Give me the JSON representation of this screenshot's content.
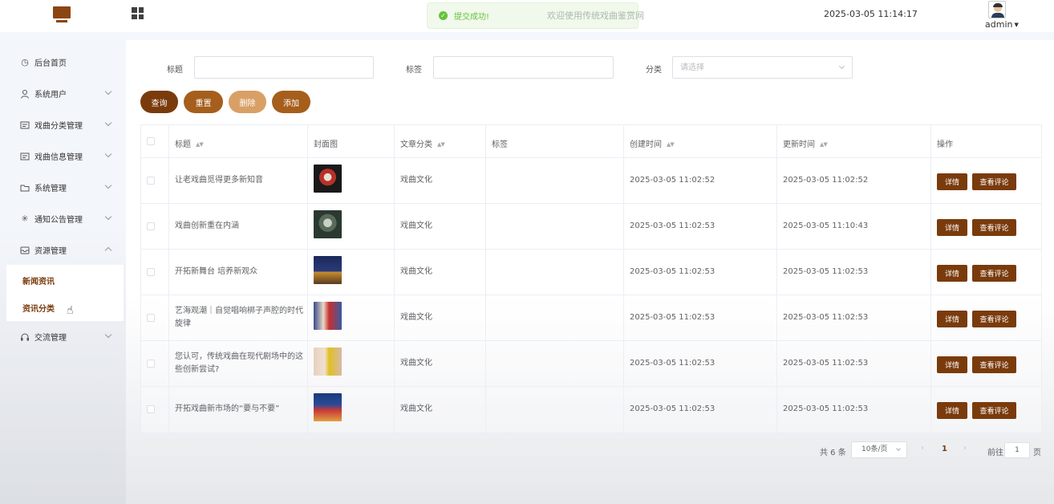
{
  "header": {
    "toast_message": "提交成功!",
    "welcome_text": "欢迎使用传统戏曲鉴赏网",
    "datetime": "2025-03-05 11:14:17",
    "username": "admin"
  },
  "sidebar": {
    "items": [
      {
        "label": "后台首页"
      },
      {
        "label": "系统用户"
      },
      {
        "label": "戏曲分类管理"
      },
      {
        "label": "戏曲信息管理"
      },
      {
        "label": "系统管理"
      },
      {
        "label": "通知公告管理"
      },
      {
        "label": "资源管理"
      },
      {
        "label": "交流管理"
      }
    ],
    "sub_items": [
      {
        "label": "新闻资讯"
      },
      {
        "label": "资讯分类"
      }
    ]
  },
  "search": {
    "title_label": "标题",
    "tag_label": "标签",
    "category_label": "分类",
    "category_placeholder": "请选择"
  },
  "buttons": {
    "query": "查询",
    "reset": "重置",
    "delete": "删除",
    "add": "添加"
  },
  "table": {
    "headers": {
      "title": "标题",
      "cover": "封面图",
      "category": "文章分类",
      "tags": "标签",
      "created": "创建时间",
      "updated": "更新时间",
      "actions": "操作"
    },
    "detail_label": "详情",
    "comments_label": "查看评论",
    "rows": [
      {
        "title": "让老戏曲觅得更多新知音",
        "category": "戏曲文化",
        "tags": "",
        "created": "2025-03-05 11:02:52",
        "updated": "2025-03-05 11:02:52"
      },
      {
        "title": "戏曲创新重在内涵",
        "category": "戏曲文化",
        "tags": "",
        "created": "2025-03-05 11:02:53",
        "updated": "2025-03-05 11:10:43"
      },
      {
        "title": "开拓新舞台 培养新观众",
        "category": "戏曲文化",
        "tags": "",
        "created": "2025-03-05 11:02:53",
        "updated": "2025-03-05 11:02:53"
      },
      {
        "title": "艺海观潮｜自觉唱响梆子声腔的时代旋律",
        "category": "戏曲文化",
        "tags": "",
        "created": "2025-03-05 11:02:53",
        "updated": "2025-03-05 11:02:53"
      },
      {
        "title": "您认可，传统戏曲在现代剧场中的这些创新尝试?",
        "category": "戏曲文化",
        "tags": "",
        "created": "2025-03-05 11:02:53",
        "updated": "2025-03-05 11:02:53"
      },
      {
        "title": "开拓戏曲新市场的“要与不要”",
        "category": "戏曲文化",
        "tags": "",
        "created": "2025-03-05 11:02:53",
        "updated": "2025-03-05 11:02:53"
      }
    ]
  },
  "pagination": {
    "total_text": "共 6 条",
    "page_size": "10条/页",
    "current_page": "1",
    "goto_label": "前往",
    "goto_value": "1",
    "page_suffix": "页"
  },
  "colors": {
    "primary": "#7a3b0c",
    "secondary": "#a65e1c",
    "light": "#d9a066",
    "success": "#67c23a"
  }
}
